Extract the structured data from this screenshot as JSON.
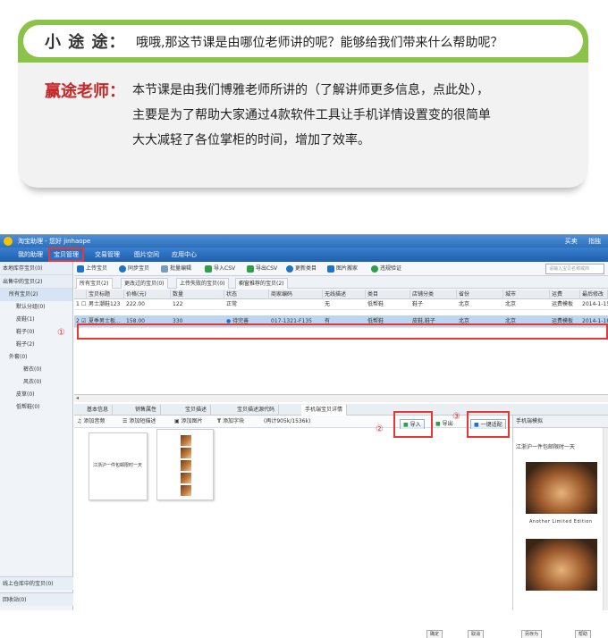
{
  "dialogue": {
    "q_speaker": "小 途 途：",
    "q_text": "哦哦,那这节课是由哪位老师讲的呢？能够给我们带来什么帮助呢？",
    "a_speaker": "赢途老师：",
    "a_lines": [
      "本节课是由我们博雅老师所讲的（了解讲师更多信息，点此处），",
      "主要是为了帮助大家通过4款软件工具让手机详情设置变的很简单",
      "大大减轻了各位掌柜的时间，增加了效率。"
    ]
  },
  "app": {
    "title": "淘宝助理 - 您好 jinhaope",
    "title_right": "买卖",
    "title_right2": "指独",
    "nav": [
      "我的助理",
      "宝贝管理",
      "交易管理",
      "图片空间",
      "应用中心"
    ],
    "sidebar": {
      "top1": "本地库存宝贝(0)",
      "top2": "出售中的宝贝(2)",
      "items": [
        "所有宝贝(2)",
        "默认分组(0)",
        "皮鞋(1)",
        "鞋子(0)",
        "鞋子(2)",
        "外套(0)",
        "裤衣(0)",
        "风衣(0)",
        "皮草(0)",
        "低帮鞋(0)"
      ],
      "bottom1": "线上仓库中的宝贝(0)",
      "bottom2": "回收站(0)"
    },
    "toolbar": [
      "上传宝贝",
      "同步宝贝",
      "批量编辑",
      "导入CSV",
      "导出CSV",
      "更新类目",
      "图片搬家",
      "违规验证"
    ],
    "search_placeholder": "请输入宝贝名称或商",
    "subtabs": [
      "所有宝贝(2)",
      "更改过的宝贝(0)",
      "上传失败的宝贝(0)",
      "橱窗推荐的宝贝(2)"
    ],
    "columns": [
      "宝贝标题",
      "价格(元)",
      "数量",
      "状态",
      "商家编码",
      "无线描述",
      "类目",
      "店铺分类",
      "省份",
      "城市",
      "运费",
      "最后修改"
    ],
    "rows": [
      {
        "no": "1",
        "check": "☐",
        "title": "男士潮鞋123",
        "price": "222.00",
        "qty": "122",
        "status": "正常",
        "code": "",
        "wireless": "无",
        "cat": "低帮鞋",
        "shopcat": "鞋子",
        "prov": "北京",
        "city": "北京",
        "freight": "运费模板",
        "modified": "2014-1-15"
      },
      {
        "no": "2",
        "check": "☑",
        "title": "夏季男士板...",
        "price": "158.00",
        "qty": "330",
        "status": "待完善",
        "code": "017-1321-F135",
        "wireless": "有",
        "cat": "低帮鞋",
        "shopcat": "皮鞋,鞋子",
        "prov": "北京",
        "city": "北京",
        "freight": "运费模板",
        "modified": "2014-1-18"
      }
    ],
    "bottom_tabs": [
      "基本信息",
      "销售属性",
      "宝贝描述",
      "宝贝描述源代码",
      "手机端宝贝详情"
    ],
    "editor_tools": [
      "添加音频",
      "添加短描述",
      "添加图片",
      "添加字块"
    ],
    "editor_info": "(再计905k/1536k)",
    "import_btn": "导入",
    "export_btn": "导出",
    "adapt_btn": "一键适配",
    "markers": [
      "①",
      "②",
      "③"
    ],
    "thumb_text": "江浙沪一件包邮限时一天",
    "phone": {
      "title": "手机端模拟",
      "text": "江浙沪一件包邮限时一天",
      "caption": "Another Limited Edition"
    },
    "footer_btns": [
      "确定",
      "取消",
      "另存为",
      "帮助"
    ]
  }
}
